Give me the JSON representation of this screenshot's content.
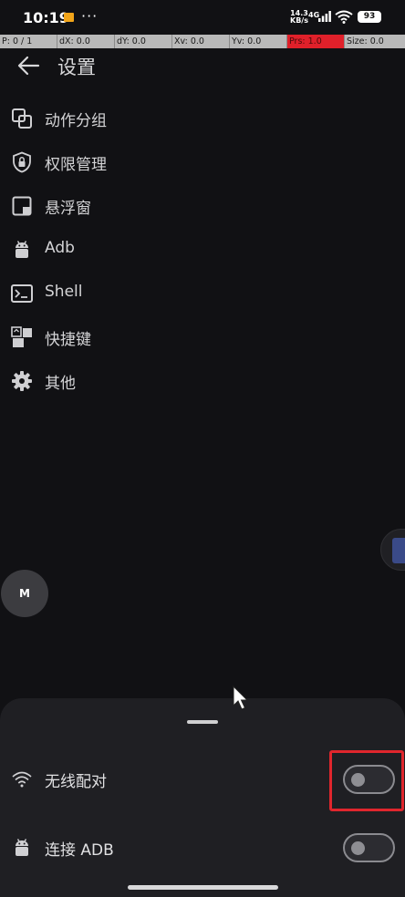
{
  "status_bar": {
    "time": "10:19",
    "net_speed_value": "14.3",
    "net_speed_unit": "KB/s",
    "network_type": "4G",
    "battery": "93",
    "more": "···"
  },
  "pointer_info": {
    "cells": [
      "P: 0 / 1",
      "dX: 0.0",
      "dY: 0.0",
      "Xv: 0.0",
      "Yv: 0.0",
      "Prs: 1.0",
      "Size: 0.0"
    ]
  },
  "header": {
    "title": "设置",
    "back_icon": "arrow-left-icon"
  },
  "menu": {
    "items": [
      {
        "label": "动作分组",
        "icon": "layers-icon"
      },
      {
        "label": "权限管理",
        "icon": "shield-lock-icon"
      },
      {
        "label": "悬浮窗",
        "icon": "floating-window-icon"
      },
      {
        "label": "Adb",
        "icon": "android-icon"
      },
      {
        "label": "Shell",
        "icon": "terminal-icon"
      },
      {
        "label": "快捷键",
        "icon": "shortcut-icon"
      },
      {
        "label": "其他",
        "icon": "gear-icon"
      }
    ]
  },
  "floating": {
    "badge": "M"
  },
  "sheet": {
    "rows": [
      {
        "label": "无线配对",
        "icon": "wifi-icon",
        "toggle_on": false
      },
      {
        "label": "连接 ADB",
        "icon": "android-icon",
        "toggle_on": false
      }
    ]
  },
  "colors": {
    "background": "#111114",
    "sheet": "#1f1f23",
    "highlight": "#e0262d",
    "pressure_cell": "#e0202a"
  }
}
